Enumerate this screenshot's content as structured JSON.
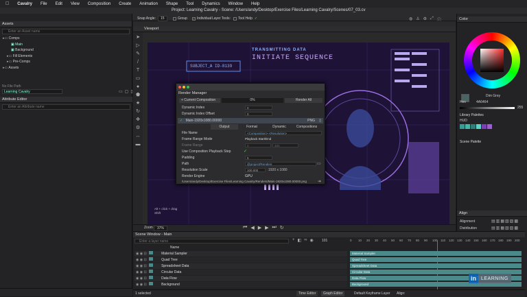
{
  "menubar": {
    "apple_icon": "apple-icon",
    "items": [
      "Cavalry",
      "File",
      "Edit",
      "View",
      "Composition",
      "Create",
      "Animation",
      "Shape",
      "Tool",
      "Dynamics",
      "Window",
      "Help"
    ]
  },
  "window": {
    "title": "Project: Learning Cavalry - Scene: /Users/andy/Desktop/Exercise Files/Learning Cavalry/Scenes/07_03.cv"
  },
  "toolbar": {
    "snap_angle_label": "Snap Angle:",
    "snap_angle_value": "15",
    "group_label": "Group",
    "individual_label": "Individual",
    "layer_tools_label": "Layer Tools:",
    "tool_help_label": "Tool Help"
  },
  "assets": {
    "header": "Assets",
    "search_placeholder": "Enter an Asset name",
    "tree": [
      {
        "label": "Comps",
        "indent": 0,
        "sel": false
      },
      {
        "label": "Main",
        "indent": 2,
        "sel": true
      },
      {
        "label": "Background",
        "indent": 2,
        "sel": false
      },
      {
        "label": "Fill Elements",
        "indent": 1,
        "sel": false
      },
      {
        "label": "Pre-Comps",
        "indent": 1,
        "sel": false
      },
      {
        "label": "Assets",
        "indent": 0,
        "sel": false
      }
    ],
    "bottom_label": "No File Path",
    "project_dropdown": "Learning Cavalry"
  },
  "attribute_editor": {
    "header": "Attribute Editor",
    "search_placeholder": "Enter an Attribute name"
  },
  "viewport": {
    "tab": "Viewport",
    "zoom_label": "Zoom",
    "zoom_value": "37%",
    "hint1": "Alt + click + drag",
    "hint2": "Shift",
    "scene_line1": "TRANSMITTING DATA",
    "scene_line2": "INITIATE SEQUENCE",
    "scene_id": "SUBJECT_A ID-8139"
  },
  "render_manager": {
    "title": "Render Manager",
    "current_composition": "+ Current Composition",
    "progress": "0%",
    "render_all": "Render All",
    "dynamic_index_label": "Dynamic Index",
    "dynamic_index_value": "0",
    "dynamic_index_offset_label": "Dynamic Index Offset",
    "dynamic_index_offset_value": "0",
    "queue_item": "Main-1920x1080.00000",
    "format_tag": "PNG",
    "tabs": [
      "Output",
      "Format",
      "Dynamic",
      "Compositions"
    ],
    "file_name_label": "File Name",
    "file_name_value": "<Composition>-<Resolution>",
    "frame_range_mode_label": "Frame Range Mode",
    "frame_range_mode_value": "Playback Start/End",
    "frame_range_label": "Frame Range",
    "frame_range_start": "0",
    "frame_range_end": "300",
    "use_comp_playback_label": "Use Composition Playback Step",
    "padding_label": "Padding",
    "padding_value": "5",
    "path_label": "Path",
    "path_value": "@project/Renders",
    "resolution_scale_label": "Resolution Scale",
    "resolution_scale_value": "100.000",
    "resolution_value": "1920 x 1080",
    "render_engine_label": "Render Engine",
    "render_engine_value": "GPU",
    "output_path": "/Users/andy/Desktop/Exercise Files/Learning Cavalry/Renders/Main-1920x1080.00000.png"
  },
  "color": {
    "header": "Color",
    "hex_label": "Hex",
    "hex_value": "4A6464",
    "swatch_name": "Dim Grey",
    "value_number": "255",
    "library_palettes": "Library Palettes",
    "hud_label": "HUD",
    "swatches": [
      "#3a9a96",
      "#45b7a6",
      "#2e7d7a",
      "#5ed3c4",
      "#7a3fb3",
      "#9b5fd0"
    ],
    "scene_palette": "Scene Palette"
  },
  "align": {
    "header": "Align",
    "alignment_label": "Alignment",
    "distribution_label": "Distribution"
  },
  "scene_window": {
    "header": "Scene Window - Main",
    "search_placeholder": "Enter a layer name",
    "current_frame": "101",
    "name_column": "Name",
    "layers": [
      "Material Sampler",
      "Quad Tree",
      "Spreadsheet Data",
      "Circular Data",
      "Data Flow",
      "Background"
    ],
    "ruler": [
      "0",
      "10",
      "20",
      "30",
      "40",
      "50",
      "60",
      "70",
      "80",
      "90",
      "100",
      "110",
      "120",
      "130",
      "140",
      "150",
      "160",
      "170",
      "180",
      "190",
      "200"
    ],
    "selected_count": "1 selected",
    "time_editor": "Time Editor",
    "graph_editor": "Graph Editor",
    "keyframe_layer": "Default Keyframe Layer",
    "align_label": "Align:"
  },
  "watermark": {
    "logo": "in",
    "text": "LEARNING"
  }
}
